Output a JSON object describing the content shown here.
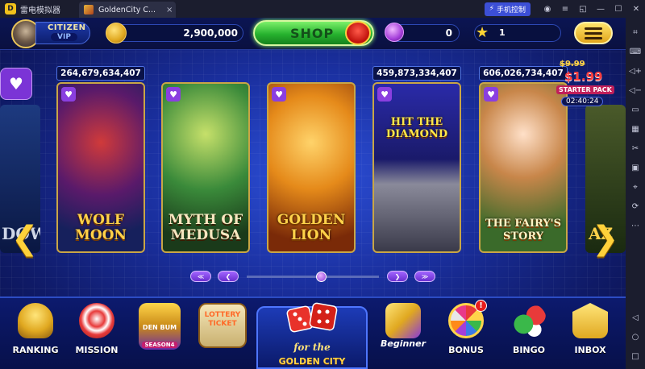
{
  "titlebar": {
    "app_name": "雷电模拟器",
    "app_logo_letter": "D",
    "tab_label": "GoldenCity C...",
    "tab_close": "×",
    "control_button": "手机控制",
    "window_buttons": [
      "user-icon",
      "menu-icon",
      "restore-icon",
      "minimize-icon",
      "maximize-icon",
      "close-icon"
    ]
  },
  "sidebar": {
    "icons": [
      "gamepad-icon",
      "keyboard-icon",
      "volume-up-icon",
      "volume-down-icon",
      "screen-icon",
      "apk-icon",
      "scissors-icon",
      "record-icon",
      "location-icon",
      "sync-icon",
      "more-icon",
      "back-icon",
      "home-icon",
      "recent-icon"
    ]
  },
  "hud": {
    "level_name": "CITIZEN",
    "level_tier": "VIP",
    "coins": "2,900,000",
    "shop_label": "SHOP",
    "gems": "0",
    "stars": "1"
  },
  "cards": [
    {
      "title_1": "WOLF",
      "title_2": "MOON",
      "jackpot": "264,679,634,407"
    },
    {
      "title_1": "MYTH OF",
      "title_2": "MEDUSA",
      "jackpot": ""
    },
    {
      "title_1": "GOLDEN",
      "title_2": "LION",
      "jackpot": ""
    },
    {
      "title_1": "HIT THE",
      "title_2": "DIAMOND",
      "jackpot": "459,873,334,407"
    },
    {
      "title_1": "THE FAIRY'S",
      "title_2": "STORY",
      "jackpot": "606,026,734,407"
    }
  ],
  "partial_cards": {
    "left_text": "DOW",
    "right_text": "AZ"
  },
  "favorite_glyph": "♥",
  "starter_pack": {
    "old_price": "$9.99",
    "price": "$1.99",
    "name": "STARTER PACK",
    "timer": "02:40:24"
  },
  "arrows": {
    "left": "❮",
    "right": "❯"
  },
  "pagination": {
    "first": "≪",
    "prev": "❮",
    "next": "❯",
    "last": "≫",
    "position": 0.56
  },
  "bottom_nav": {
    "ranking": "RANKING",
    "mission": "MISSION",
    "album_text": "DEN BUM",
    "album_season": "SEASON4",
    "lottery_label": "LOTTERY TICKET",
    "center_sub": "for the",
    "center_label": "GOLDEN CITY",
    "beginner": "Beginner",
    "bonus": "BONUS",
    "bonus_badge": "!",
    "bingo": "BINGO",
    "inbox": "INBOX"
  },
  "colors": {
    "accent_gold": "#ffd24a",
    "background_blue": "#1a2f9e",
    "shop_green": "#27b22f",
    "favorite_purple": "#8a3fe0"
  }
}
